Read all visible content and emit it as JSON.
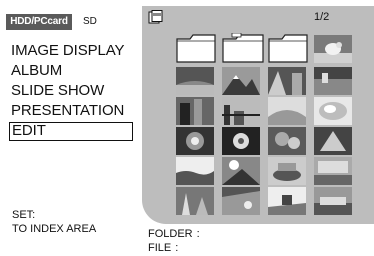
{
  "source_tabs": [
    {
      "label": "HDD/PCcard",
      "active": true
    },
    {
      "label": "SD",
      "active": false
    }
  ],
  "menu": {
    "items": [
      {
        "label": "IMAGE DISPLAY"
      },
      {
        "label": "ALBUM"
      },
      {
        "label": "SLIDE SHOW"
      },
      {
        "label": "PRESENTATION"
      },
      {
        "label": "EDIT",
        "selected": true
      }
    ]
  },
  "instruction": {
    "label": "SET:",
    "description": "TO INDEX AREA"
  },
  "index_area": {
    "page_indicator": "1/2",
    "page_icon": "memory-card-icon"
  },
  "info": {
    "folder_label": "FOLDER",
    "folder_value": ":",
    "file_label": "FILE",
    "file_value": ":"
  },
  "colors": {
    "panel_bg": "#bdbdbd",
    "active_tab_bg": "#5a5a5a"
  }
}
